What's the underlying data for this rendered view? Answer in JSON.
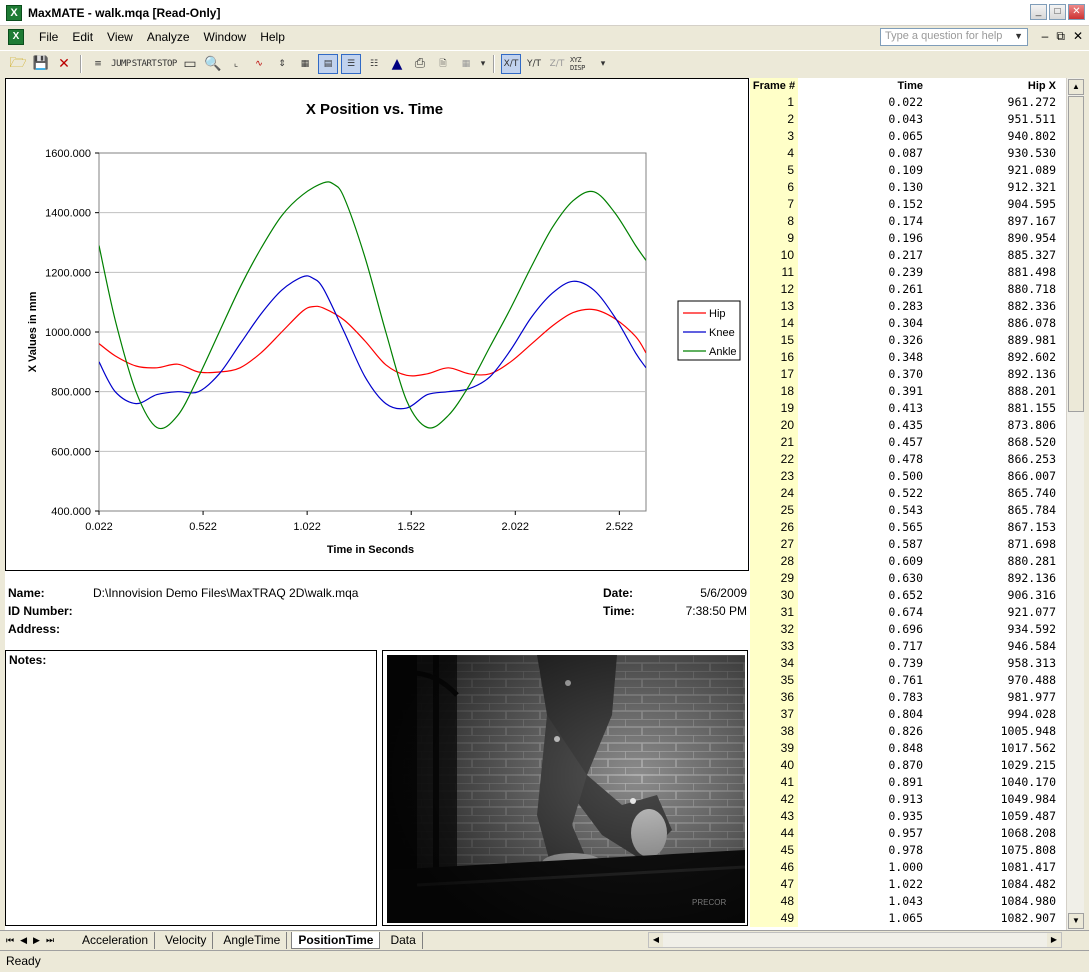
{
  "window": {
    "title": "MaxMATE - walk.mqa  [Read-Only]",
    "app_icon": "X"
  },
  "menu": {
    "items": [
      "File",
      "Edit",
      "View",
      "Analyze",
      "Window",
      "Help"
    ],
    "help_placeholder": "Type a question for help"
  },
  "toolbar": {
    "labels": [
      "JUMP",
      "START",
      "STOP",
      "XYZ DISP"
    ]
  },
  "chart_data": {
    "type": "line",
    "title": "X Position vs. Time",
    "xlabel": "Time in Seconds",
    "ylabel": "X Values in mm",
    "xlim": [
      0.022,
      2.65
    ],
    "ylim": [
      400,
      1600
    ],
    "x_ticks": [
      "0.022",
      "0.522",
      "1.022",
      "1.522",
      "2.022",
      "2.522"
    ],
    "y_ticks": [
      "400.000",
      "600.000",
      "800.000",
      "1000.000",
      "1200.000",
      "1400.000",
      "1600.000"
    ],
    "grid": true,
    "legend_position": "right",
    "series": [
      {
        "name": "Hip",
        "color": "#ff0000",
        "x": [
          0.022,
          0.1,
          0.2,
          0.3,
          0.4,
          0.5,
          0.6,
          0.7,
          0.8,
          0.9,
          1.0,
          1.05,
          1.1,
          1.2,
          1.3,
          1.4,
          1.5,
          1.6,
          1.7,
          1.8,
          1.9,
          2.0,
          2.1,
          2.2,
          2.3,
          2.4,
          2.5,
          2.6,
          2.65
        ],
        "values": [
          961,
          920,
          886,
          880,
          892,
          866,
          866,
          880,
          930,
          1000,
          1070,
          1085,
          1080,
          1040,
          970,
          890,
          855,
          860,
          880,
          860,
          860,
          900,
          960,
          1020,
          1065,
          1075,
          1045,
          985,
          930
        ]
      },
      {
        "name": "Knee",
        "color": "#0000cc",
        "x": [
          0.022,
          0.1,
          0.2,
          0.3,
          0.4,
          0.5,
          0.6,
          0.7,
          0.8,
          0.9,
          1.0,
          1.05,
          1.1,
          1.2,
          1.3,
          1.4,
          1.5,
          1.6,
          1.7,
          1.8,
          1.9,
          2.0,
          2.1,
          2.2,
          2.3,
          2.4,
          2.5,
          2.6,
          2.65
        ],
        "values": [
          900,
          800,
          760,
          790,
          800,
          800,
          860,
          960,
          1060,
          1140,
          1185,
          1180,
          1145,
          1000,
          850,
          760,
          745,
          790,
          800,
          810,
          850,
          940,
          1050,
          1130,
          1170,
          1140,
          1050,
          930,
          880
        ]
      },
      {
        "name": "Ankle",
        "color": "#008000",
        "x": [
          0.022,
          0.1,
          0.2,
          0.3,
          0.4,
          0.5,
          0.6,
          0.7,
          0.8,
          0.9,
          1.0,
          1.1,
          1.15,
          1.2,
          1.3,
          1.4,
          1.5,
          1.6,
          1.7,
          1.8,
          1.9,
          2.0,
          2.1,
          2.2,
          2.3,
          2.4,
          2.5,
          2.6,
          2.65
        ],
        "values": [
          1290,
          1040,
          800,
          680,
          720,
          850,
          1000,
          1150,
          1280,
          1390,
          1460,
          1500,
          1495,
          1450,
          1250,
          1000,
          770,
          680,
          720,
          820,
          950,
          1080,
          1220,
          1350,
          1440,
          1470,
          1400,
          1290,
          1240
        ]
      }
    ]
  },
  "info": {
    "name_label": "Name:",
    "name_value": "D:\\Innovision Demo Files\\MaxTRAQ 2D\\walk.mqa",
    "id_label": "ID Number:",
    "address_label": "Address:",
    "date_label": "Date:",
    "date_value": "5/6/2009",
    "time_label": "Time:",
    "time_value": "7:38:50 PM",
    "notes_label": "Notes:"
  },
  "video": {
    "watermark": "PRECOR"
  },
  "table": {
    "headers": [
      "Frame #",
      "Time",
      "Hip X"
    ],
    "rows": [
      [
        "1",
        "0.022",
        "961.272"
      ],
      [
        "2",
        "0.043",
        "951.511"
      ],
      [
        "3",
        "0.065",
        "940.802"
      ],
      [
        "4",
        "0.087",
        "930.530"
      ],
      [
        "5",
        "0.109",
        "921.089"
      ],
      [
        "6",
        "0.130",
        "912.321"
      ],
      [
        "7",
        "0.152",
        "904.595"
      ],
      [
        "8",
        "0.174",
        "897.167"
      ],
      [
        "9",
        "0.196",
        "890.954"
      ],
      [
        "10",
        "0.217",
        "885.327"
      ],
      [
        "11",
        "0.239",
        "881.498"
      ],
      [
        "12",
        "0.261",
        "880.718"
      ],
      [
        "13",
        "0.283",
        "882.336"
      ],
      [
        "14",
        "0.304",
        "886.078"
      ],
      [
        "15",
        "0.326",
        "889.981"
      ],
      [
        "16",
        "0.348",
        "892.602"
      ],
      [
        "17",
        "0.370",
        "892.136"
      ],
      [
        "18",
        "0.391",
        "888.201"
      ],
      [
        "19",
        "0.413",
        "881.155"
      ],
      [
        "20",
        "0.435",
        "873.806"
      ],
      [
        "21",
        "0.457",
        "868.520"
      ],
      [
        "22",
        "0.478",
        "866.253"
      ],
      [
        "23",
        "0.500",
        "866.007"
      ],
      [
        "24",
        "0.522",
        "865.740"
      ],
      [
        "25",
        "0.543",
        "865.784"
      ],
      [
        "26",
        "0.565",
        "867.153"
      ],
      [
        "27",
        "0.587",
        "871.698"
      ],
      [
        "28",
        "0.609",
        "880.281"
      ],
      [
        "29",
        "0.630",
        "892.136"
      ],
      [
        "30",
        "0.652",
        "906.316"
      ],
      [
        "31",
        "0.674",
        "921.077"
      ],
      [
        "32",
        "0.696",
        "934.592"
      ],
      [
        "33",
        "0.717",
        "946.584"
      ],
      [
        "34",
        "0.739",
        "958.313"
      ],
      [
        "35",
        "0.761",
        "970.488"
      ],
      [
        "36",
        "0.783",
        "981.977"
      ],
      [
        "37",
        "0.804",
        "994.028"
      ],
      [
        "38",
        "0.826",
        "1005.948"
      ],
      [
        "39",
        "0.848",
        "1017.562"
      ],
      [
        "40",
        "0.870",
        "1029.215"
      ],
      [
        "41",
        "0.891",
        "1040.170"
      ],
      [
        "42",
        "0.913",
        "1049.984"
      ],
      [
        "43",
        "0.935",
        "1059.487"
      ],
      [
        "44",
        "0.957",
        "1068.208"
      ],
      [
        "45",
        "0.978",
        "1075.808"
      ],
      [
        "46",
        "1.000",
        "1081.417"
      ],
      [
        "47",
        "1.022",
        "1084.482"
      ],
      [
        "48",
        "1.043",
        "1084.980"
      ],
      [
        "49",
        "1.065",
        "1082.907"
      ]
    ]
  },
  "tabs": {
    "items": [
      "Acceleration",
      "Velocity",
      "AngleTime",
      "PositionTime",
      "Data"
    ],
    "active": "PositionTime"
  },
  "status": {
    "text": "Ready"
  }
}
